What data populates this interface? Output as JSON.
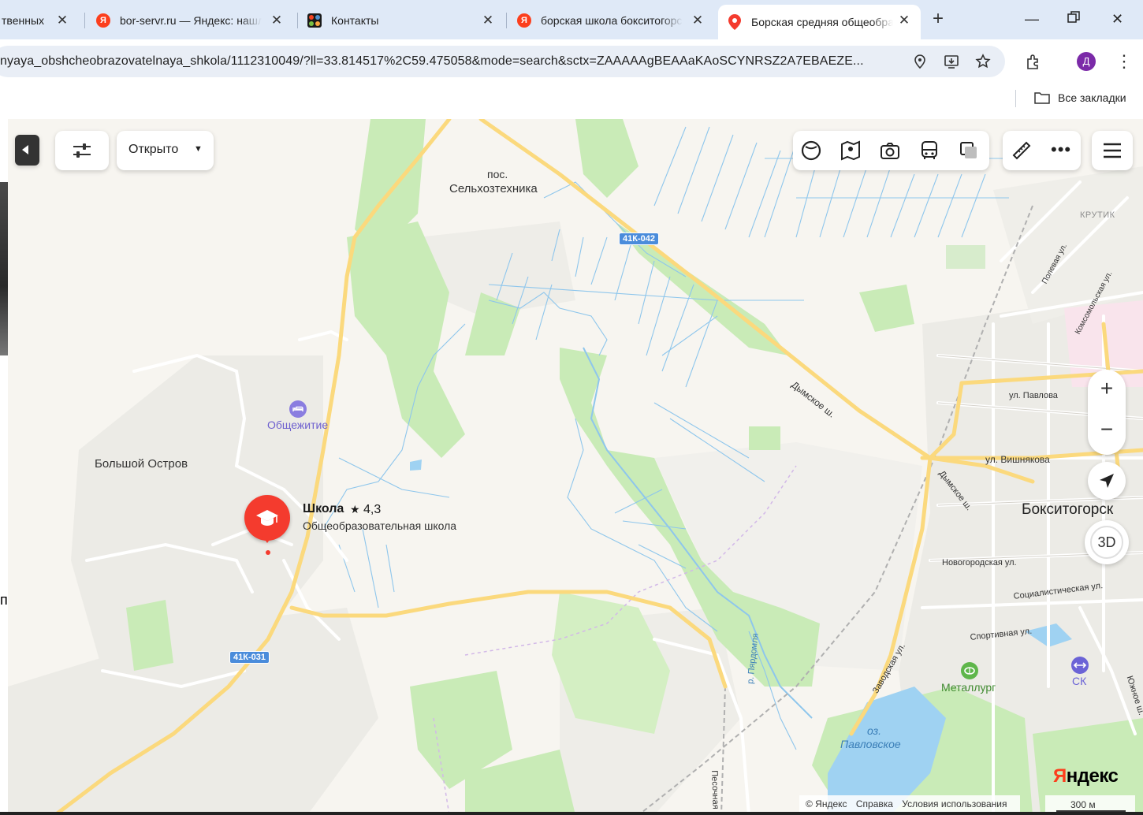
{
  "browser": {
    "tabs": [
      {
        "title": "твенных",
        "favicon": "none"
      },
      {
        "title": "bor-servr.ru — Яндекс: нашлось",
        "favicon": "yandex"
      },
      {
        "title": "Контакты",
        "favicon": "joomla"
      },
      {
        "title": "борская школа бокситогорск",
        "favicon": "yandex"
      },
      {
        "title": "Борская средняя общеобразовательная",
        "favicon": "maps-pin",
        "active": true
      }
    ],
    "new_tab_label": "+",
    "url": "nyaya_obshcheobrazovatelnaya_shkola/1112310049/?ll=33.814517%2C59.475058&mode=search&sctx=ZAAAAAgBEAAaKAoSCYNRSZ2A7EBAEZE...",
    "avatar_letter": "Д",
    "bookmarks_all": "Все закладки"
  },
  "map": {
    "controls": {
      "filter_status": "Открыто",
      "zoom_in": "+",
      "zoom_out": "−",
      "btn_3d": "3D"
    },
    "selected_place": {
      "name": "Школа",
      "rating": "4,3",
      "category": "Общеобразовательная школа"
    },
    "labels": {
      "settlement_pos": "пос.",
      "settlement": "Сельхозтехника",
      "bolshoy_ostrov": "Большой Остров",
      "hostel": "Общежитие",
      "krutik": "КРУТИК",
      "town": "Бокситогорск",
      "metallurg": "Металлург",
      "sk": "СК",
      "lake_1": "оз.",
      "lake_2": "Павловское",
      "road_41k042": "41К-042",
      "road_41k031": "41К-031",
      "dymskoe_1": "Дымское ш.",
      "dymskoe_2": "Дымское ш.",
      "ul_pavlova": "ул. Павлова",
      "ul_vishnyakova": "ул. Вишнякова",
      "novgorodskaya": "Новогородская ул.",
      "socialisticheskaya": "Социалистическая ул.",
      "sportivnaya": "Спортивная ул.",
      "zavodskaya": "Заводская ул.",
      "polevaya": "Полевая ул.",
      "komsomolskaya": "Комсомольская ул.",
      "yuzhnoe": "Южное ш.",
      "river_pyardomlya": "р. Пярдомля",
      "pesochnaya": "Песочная"
    },
    "footer": {
      "copyright": "© Яндекс",
      "help": "Справка",
      "terms": "Условия использования",
      "scale": "300 м",
      "logo_y": "Я",
      "logo_rest": "ндекс"
    },
    "left_edge_letter": "п"
  },
  "colors": {
    "forest": "#c9ebb7",
    "road_main": "#fbd97d",
    "water": "#9fd2f2",
    "accent_pin": "#f43b2e",
    "urban": "#ecebe6"
  }
}
